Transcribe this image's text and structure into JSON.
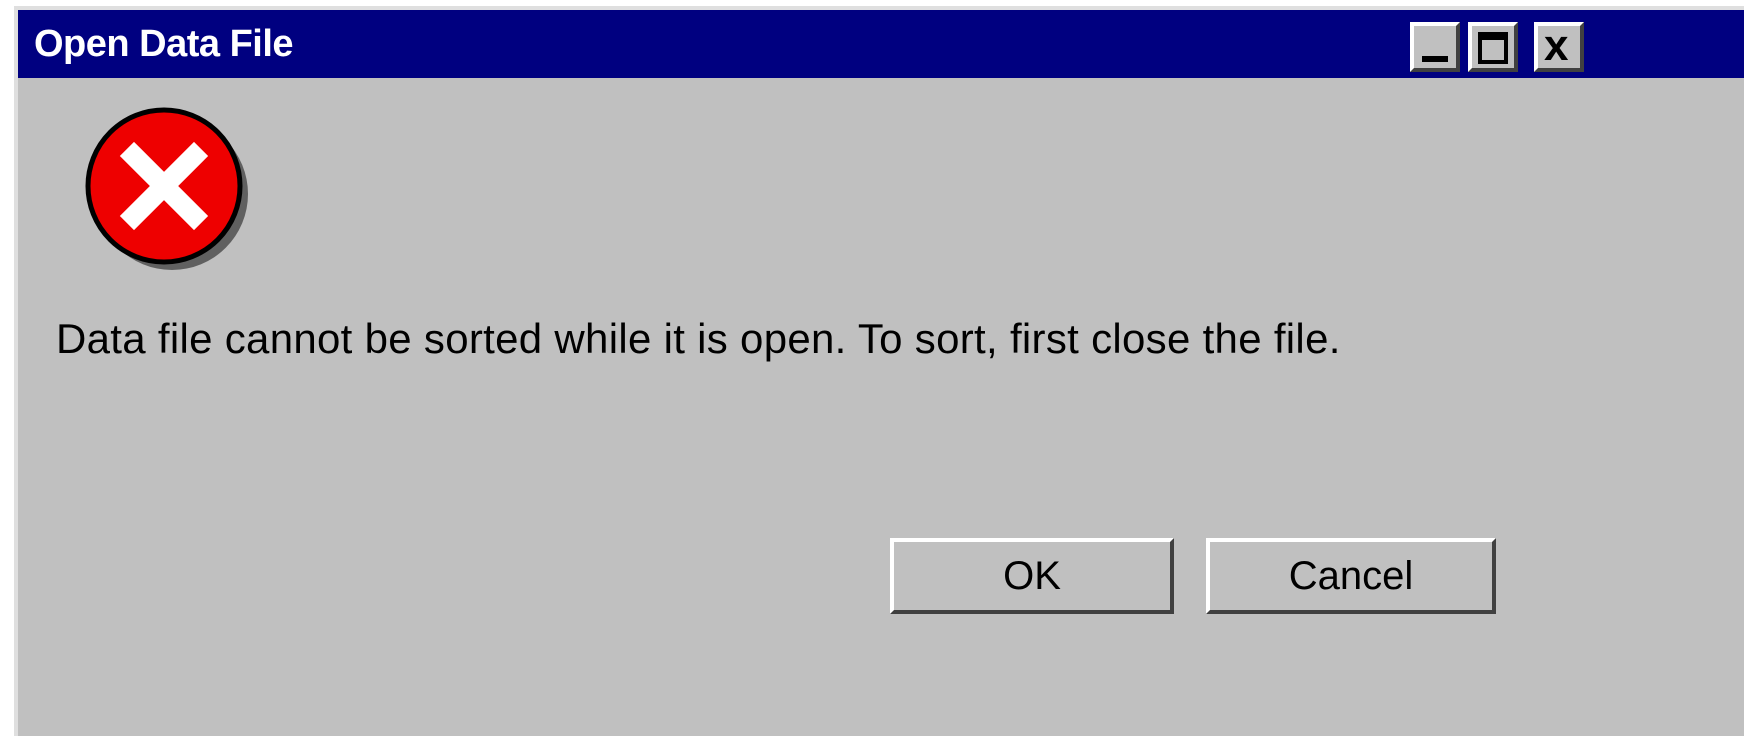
{
  "window": {
    "title": "Open Data File",
    "controls": {
      "minimize": "_",
      "maximize": "□",
      "close": "x"
    }
  },
  "icon": {
    "name": "error-icon",
    "color": "#ee0000"
  },
  "message": "Data file cannot be sorted while it is open.  To sort, first close the file.",
  "buttons": {
    "ok_label": "OK",
    "cancel_label": "Cancel"
  },
  "colors": {
    "titlebar": "#000080",
    "dialog_bg": "#c0c0c0"
  }
}
